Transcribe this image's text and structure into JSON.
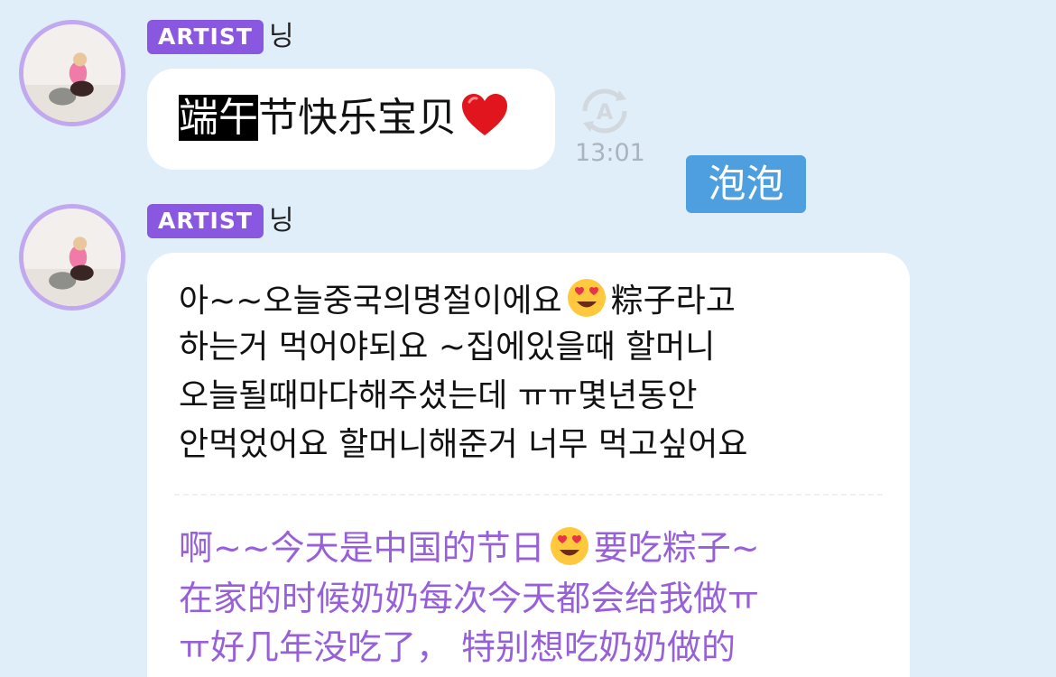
{
  "messages": [
    {
      "badge": "ARTIST",
      "nickname": "닝",
      "text_highlight": "端午",
      "text_rest": "节快乐宝贝",
      "emoji": "red-heart",
      "time": "13:01"
    },
    {
      "badge": "ARTIST",
      "nickname": "닝",
      "lines": [
        {
          "before": "아~~오늘중국의명절이에요",
          "emoji": "heart-eyes",
          "after": "粽子라고"
        },
        {
          "text": "하는거 먹어야되요 ~집에있을때 할머니"
        },
        {
          "text": "오늘될때마다해주셨는데 ㅠㅠ몇년동안"
        },
        {
          "text": "안먹었어요 할머니해준거 너무 먹고싶어요"
        }
      ],
      "translation": [
        {
          "before": "啊~~今天是中国的节日",
          "emoji": "heart-eyes",
          "after": "要吃粽子~"
        },
        {
          "text": "在家的时候奶奶每次今天都会给我做ㅠ"
        },
        {
          "text": "ㅠ好几年没吃了， 特别想吃奶奶做的"
        }
      ]
    }
  ],
  "watermark": "泡泡",
  "colors": {
    "background": "#dfeef8",
    "badge": "#8a58e0",
    "avatar_ring": "#c2a8ee",
    "translation_text": "#9860d8",
    "watermark": "#4d9fe0"
  }
}
